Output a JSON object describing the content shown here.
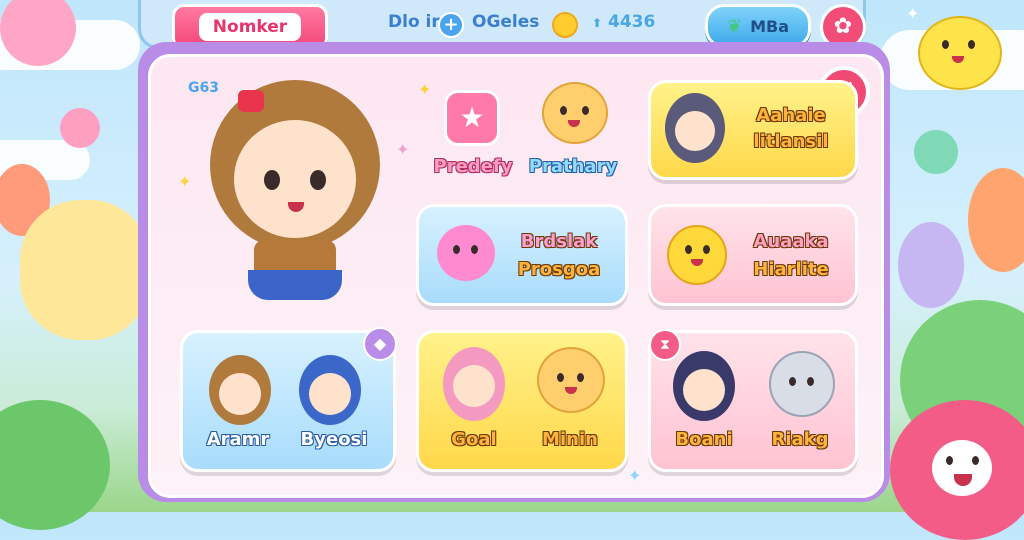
{
  "header": {
    "name_button": "Nomker",
    "stat_left": "Dlo",
    "stat_left2": "ir",
    "currency_label": "OGeles",
    "score_value": "4436",
    "right_button": "MBa"
  },
  "main": {
    "badge": "G63",
    "items": [
      {
        "label": "Predefy"
      },
      {
        "label": "Prathary"
      }
    ],
    "cards": [
      {
        "line1": "Aahaie",
        "line2": "litlansil"
      },
      {
        "line1": "Brdslak",
        "line2": "Prosgoa"
      },
      {
        "line1": "Auaaka",
        "line2": "Hiarlite"
      },
      {
        "name_a": "Aramr",
        "name_b": "Byeosi"
      },
      {
        "name_a": "Goal",
        "name_b": "Minin"
      },
      {
        "name_a": "Boani",
        "name_b": "Riakg"
      }
    ]
  },
  "icons": [
    "plus-icon",
    "coin-icon",
    "leaf-icon",
    "gear-icon",
    "close-icon",
    "diamond-icon",
    "hourglass-icon",
    "star-icon",
    "sparkle-icon"
  ],
  "colors": {
    "accent_pink": "#f14d78",
    "accent_blue": "#3fa9ea",
    "panel_purple": "#b98ce8",
    "coin_yellow": "#ffcc2e"
  }
}
